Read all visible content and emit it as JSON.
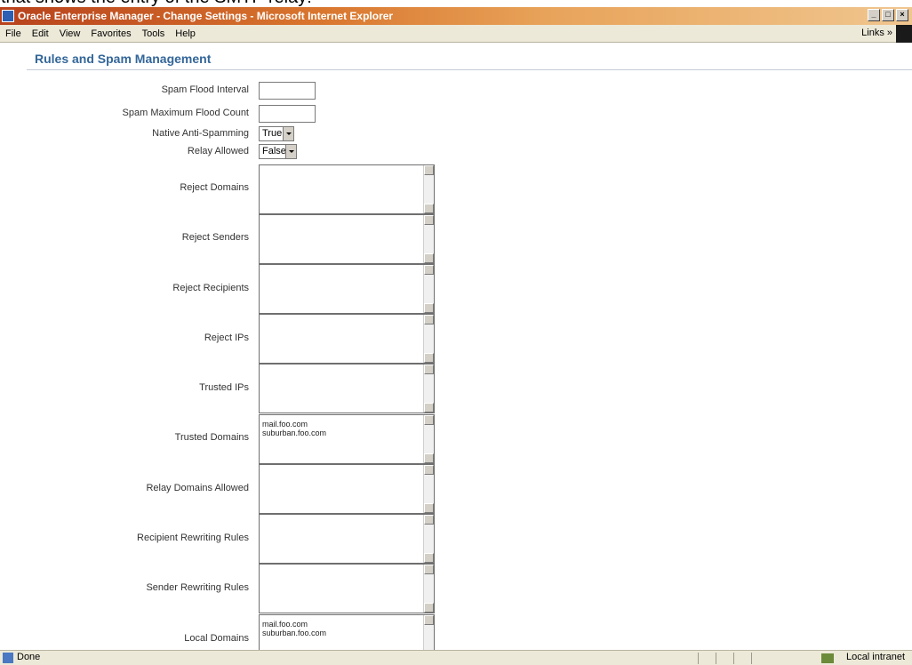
{
  "overlay": {
    "caption": "that shows the entry of the SMTP relay:"
  },
  "window": {
    "title": "Oracle Enterprise Manager - Change Settings - Microsoft Internet Explorer",
    "controls": [
      "_",
      "□",
      "×"
    ]
  },
  "menu": {
    "items": [
      "File",
      "Edit",
      "View",
      "Favorites",
      "Tools",
      "Help"
    ],
    "links": "Links »"
  },
  "page": {
    "heading": "Rules and Spam Management",
    "fields": {
      "spam_flood_interval": {
        "label": "Spam Flood Interval",
        "value": ""
      },
      "spam_max_flood_count": {
        "label": "Spam Maximum Flood Count",
        "value": ""
      },
      "native_anti_spamming": {
        "label": "Native Anti-Spamming",
        "value": "True"
      },
      "relay_allowed": {
        "label": "Relay Allowed",
        "value": "False"
      },
      "reject_domains": {
        "label": "Reject Domains",
        "value": ""
      },
      "reject_senders": {
        "label": "Reject Senders",
        "value": ""
      },
      "reject_recipients": {
        "label": "Reject Recipients",
        "value": ""
      },
      "reject_ips": {
        "label": "Reject IPs",
        "value": ""
      },
      "trusted_ips": {
        "label": "Trusted IPs",
        "value": ""
      },
      "trusted_domains": {
        "label": "Trusted Domains",
        "value": "mail.foo.com\nsuburban.foo.com"
      },
      "relay_domains_allowed": {
        "label": "Relay Domains Allowed",
        "value": ""
      },
      "recipient_rewriting_rules": {
        "label": "Recipient Rewriting Rules",
        "value": ""
      },
      "sender_rewriting_rules": {
        "label": "Sender Rewriting Rules",
        "value": ""
      },
      "local_domains": {
        "label": "Local Domains",
        "value": "mail.foo.com\nsuburban.foo.com"
      }
    }
  },
  "status": {
    "text": "Done",
    "zone": "Local intranet"
  }
}
